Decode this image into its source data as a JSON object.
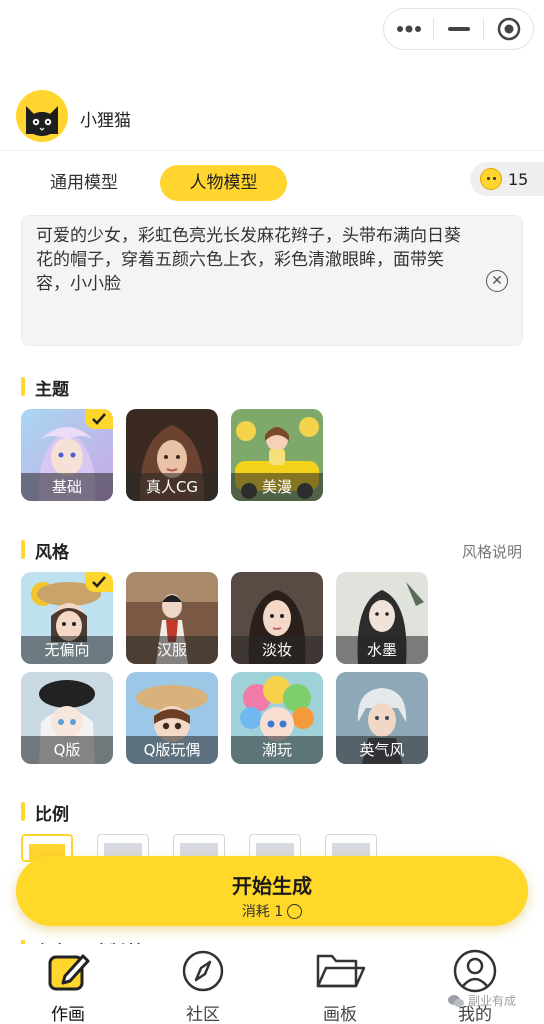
{
  "header": {
    "username": "小狸猫"
  },
  "tabs": [
    {
      "label": "通用模型"
    },
    {
      "label": "人物模型"
    }
  ],
  "credits": {
    "count": "15"
  },
  "prompt": {
    "text": "可爱的少女，彩虹色亮光长发麻花辫子，头带布满向日葵花的帽子，穿着五颜六色上衣，彩色清澈眼眸，面带笑容，小小脸"
  },
  "sections": {
    "theme": "主题",
    "style": "风格",
    "style_help": "风格说明",
    "ratio": "比例",
    "reference": "参考图（选填）"
  },
  "themes": [
    {
      "label": "基础",
      "selected": true
    },
    {
      "label": "真人CG",
      "selected": false
    },
    {
      "label": "美漫",
      "selected": false
    }
  ],
  "styles": [
    {
      "label": "无偏向",
      "selected": true
    },
    {
      "label": "汉服",
      "selected": false
    },
    {
      "label": "淡妆",
      "selected": false
    },
    {
      "label": "水墨",
      "selected": false
    },
    {
      "label": "Q版",
      "selected": false
    },
    {
      "label": "Q版玩偶",
      "selected": false
    },
    {
      "label": "潮玩",
      "selected": false
    },
    {
      "label": "英气风",
      "selected": false
    }
  ],
  "generate": {
    "title": "开始生成",
    "cost": "消耗 1"
  },
  "nav": [
    {
      "label": "作画",
      "icon": "pencil-square-icon",
      "active": true
    },
    {
      "label": "社区",
      "icon": "compass-icon",
      "active": false
    },
    {
      "label": "画板",
      "icon": "folder-icon",
      "active": false
    },
    {
      "label": "我的",
      "icon": "user-icon",
      "active": false
    }
  ],
  "watermark": "副业有成",
  "colors": {
    "accent": "#ffd52e",
    "background": "#ffffff"
  }
}
